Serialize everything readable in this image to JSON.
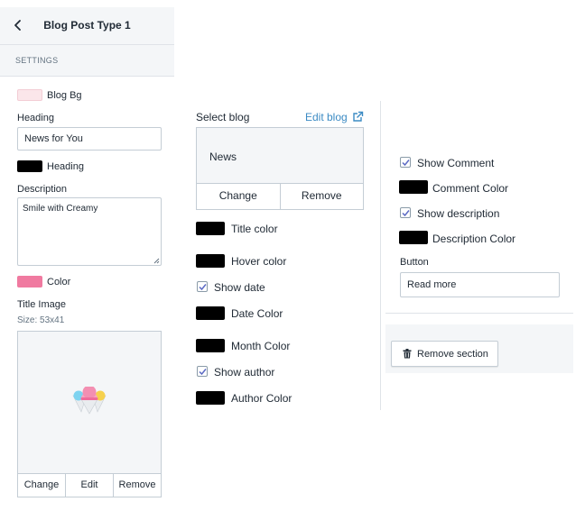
{
  "header": {
    "title": "Blog Post Type 1"
  },
  "settings": {
    "label": "SETTINGS"
  },
  "col1": {
    "blog_bg_label": "Blog Bg",
    "heading_label": "Heading",
    "heading_value": "News for You",
    "heading_color_label": "Heading",
    "description_label": "Description",
    "description_value": "Smile with Creamy",
    "color_label": "Color",
    "title_image_label": "Title Image",
    "size_label": "Size: 53x41",
    "image_actions": [
      "Change",
      "Edit",
      "Remove"
    ]
  },
  "col2": {
    "select_blog_label": "Select blog",
    "edit_blog_label": "Edit blog",
    "blog_name": "News",
    "change_label": "Change",
    "remove_label": "Remove",
    "title_color": "Title color",
    "hover_color": "Hover color",
    "show_date": "Show date",
    "date_color": "Date Color",
    "month_color": "Month Color",
    "show_author": "Show author",
    "author_color": "Author Color"
  },
  "col3": {
    "show_comment": "Show Comment",
    "comment_color": "Comment Color",
    "show_description": "Show description",
    "description_color": "Description Color",
    "button_label": "Button",
    "button_value": "Read more",
    "remove_section": "Remove section"
  },
  "colors": {
    "blog_bg": "#fbe6ea",
    "heading": "#000000",
    "color": "#f07aa0",
    "link": "#3c8bc4"
  },
  "icons": {
    "back": "chevron-left-icon",
    "external": "external-link-icon",
    "check": "checkmark-icon",
    "trash": "trash-icon",
    "image": "ice-cream-logo"
  }
}
